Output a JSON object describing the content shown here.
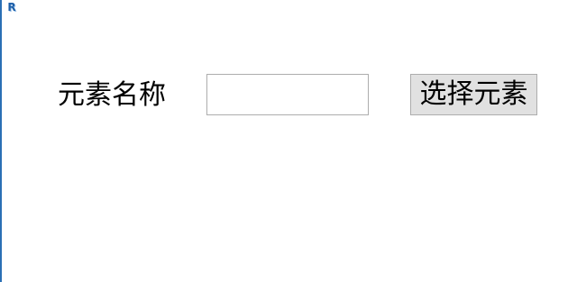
{
  "window": {
    "app_icon": "revit-r-icon",
    "app_icon_glyph": "R"
  },
  "form": {
    "element_name_label": "元素名称",
    "element_name_value": "",
    "element_name_placeholder": "",
    "select_element_button": "选择元素"
  }
}
